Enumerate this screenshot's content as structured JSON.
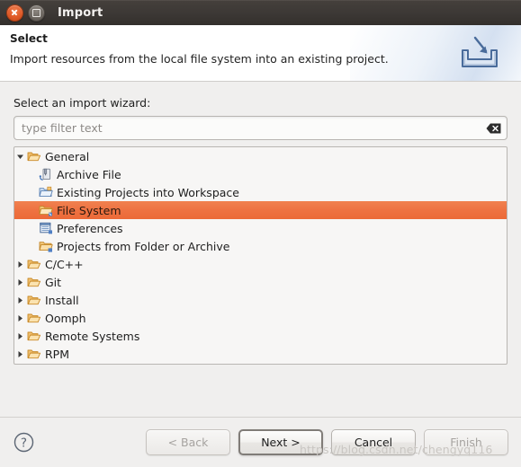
{
  "window": {
    "title": "Import",
    "close_icon": "window-close-icon",
    "maximize_icon": "window-maximize-icon"
  },
  "banner": {
    "title": "Select",
    "description": "Import resources from the local file system into an existing project.",
    "icon": "import-tray-arrow-icon"
  },
  "body": {
    "wizard_label": "Select an import wizard:",
    "filter": {
      "value": "",
      "placeholder": "type filter text",
      "clear_icon": "clear-field-icon"
    }
  },
  "tree": {
    "items": [
      {
        "label": "General",
        "level": 0,
        "icon": "folder-open-icon",
        "twisty": "expanded",
        "selected": false
      },
      {
        "label": "Archive File",
        "level": 1,
        "icon": "archive-file-icon",
        "twisty": "none",
        "selected": false
      },
      {
        "label": "Existing Projects into Workspace",
        "level": 1,
        "icon": "projects-import-icon",
        "twisty": "none",
        "selected": false
      },
      {
        "label": "File System",
        "level": 1,
        "icon": "file-system-folder-icon",
        "twisty": "none",
        "selected": true
      },
      {
        "label": "Preferences",
        "level": 1,
        "icon": "preferences-icon",
        "twisty": "none",
        "selected": false
      },
      {
        "label": "Projects from Folder or Archive",
        "level": 1,
        "icon": "folder-archive-icon",
        "twisty": "none",
        "selected": false
      },
      {
        "label": "C/C++",
        "level": 0,
        "icon": "folder-open-icon",
        "twisty": "collapsed",
        "selected": false
      },
      {
        "label": "Git",
        "level": 0,
        "icon": "folder-open-icon",
        "twisty": "collapsed",
        "selected": false
      },
      {
        "label": "Install",
        "level": 0,
        "icon": "folder-open-icon",
        "twisty": "collapsed",
        "selected": false
      },
      {
        "label": "Oomph",
        "level": 0,
        "icon": "folder-open-icon",
        "twisty": "collapsed",
        "selected": false
      },
      {
        "label": "Remote Systems",
        "level": 0,
        "icon": "folder-open-icon",
        "twisty": "collapsed",
        "selected": false
      },
      {
        "label": "RPM",
        "level": 0,
        "icon": "folder-open-icon",
        "twisty": "collapsed",
        "selected": false
      }
    ]
  },
  "footer": {
    "help_icon": "help-question-icon",
    "buttons": [
      {
        "label": "< Back",
        "name": "back-button",
        "state": "disabled"
      },
      {
        "label": "Next >",
        "name": "next-button",
        "state": "default"
      },
      {
        "label": "Cancel",
        "name": "cancel-button",
        "state": "normal"
      },
      {
        "label": "Finish",
        "name": "finish-button",
        "state": "disabled"
      }
    ]
  },
  "watermark": {
    "text": "https://blog.csdn.net/chengyq116"
  },
  "colors": {
    "selection": "#ee7242",
    "titlebar": "#3c3835",
    "banner_bg": "#ffffff",
    "dialog_bg": "#f0efee",
    "folder": "#e8a33d"
  }
}
